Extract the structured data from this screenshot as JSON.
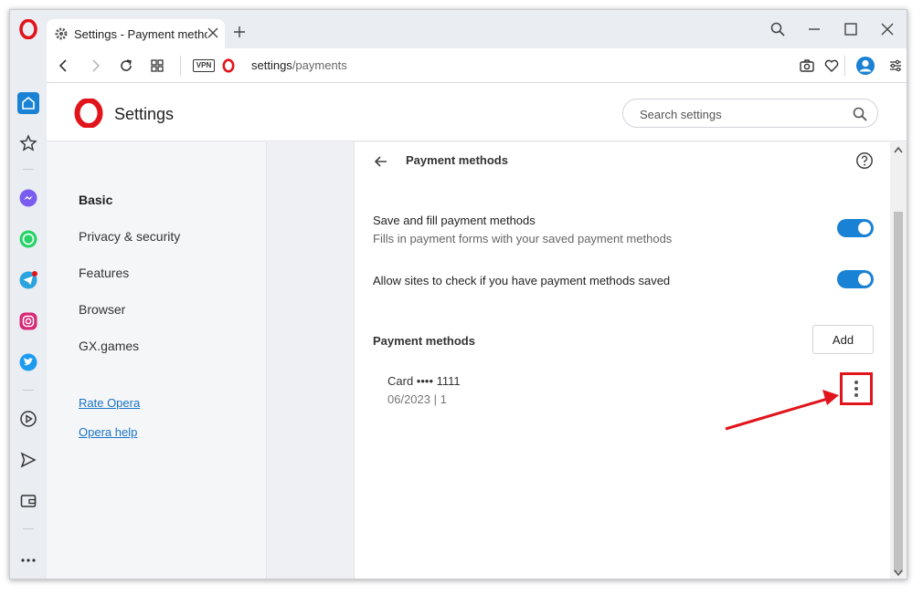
{
  "browser": {
    "tab_title": "Settings - Payment methods",
    "url_host": "settings",
    "url_path": "/payments",
    "vpn_label": "VPN"
  },
  "header": {
    "title": "Settings",
    "search_placeholder": "Search settings"
  },
  "nav": {
    "items": [
      "Basic",
      "Privacy & security",
      "Features",
      "Browser",
      "GX.games"
    ],
    "links": [
      "Rate Opera",
      "Opera help"
    ]
  },
  "payments": {
    "title": "Payment methods",
    "save_fill_title": "Save and fill payment methods",
    "save_fill_sub": "Fills in payment forms with your saved payment methods",
    "allow_check_title": "Allow sites to check if you have payment methods saved",
    "section_label": "Payment methods",
    "add_label": "Add",
    "card_title": "Card •••• 1111",
    "card_sub": "06/2023 | 1"
  },
  "colors": {
    "accent": "#1a82d4",
    "highlight": "#e1141b",
    "opera_red": "#e1141b"
  }
}
